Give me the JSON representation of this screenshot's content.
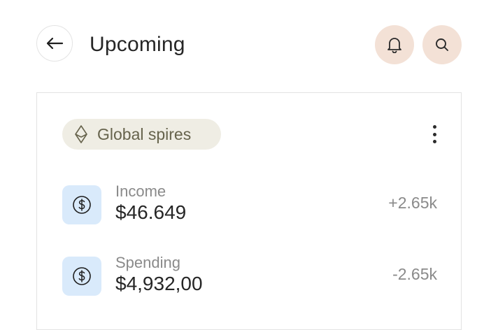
{
  "header": {
    "title": "Upcoming",
    "back_icon": "arrow-left-icon",
    "notification_icon": "bell-icon",
    "search_icon": "search-icon"
  },
  "colors": {
    "action_button_bg": "#f3e1d6",
    "chip_bg": "#efede4",
    "chip_text": "#66634c",
    "icon_box_bg": "#d9eafb"
  },
  "card": {
    "chip": {
      "label": "Global spires",
      "icon": "ethereum-icon"
    },
    "menu_icon": "more-vertical-icon",
    "transactions": [
      {
        "label": "Income",
        "amount": "$46.649",
        "change": "+2.65k",
        "icon": "dollar-circle-icon"
      },
      {
        "label": "Spending",
        "amount": "$4,932,00",
        "change": "-2.65k",
        "icon": "dollar-circle-icon"
      }
    ]
  }
}
